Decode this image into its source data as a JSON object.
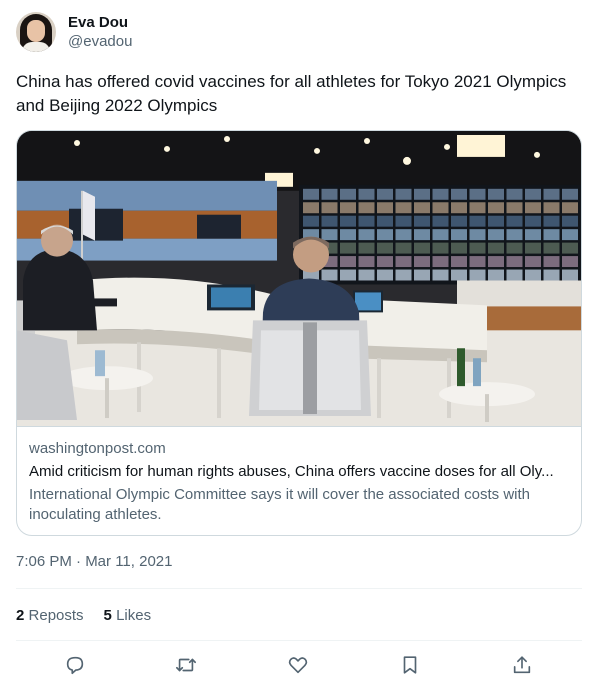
{
  "author": {
    "name": "Eva Dou",
    "handle": "@evadou"
  },
  "tweet": {
    "text": "China has offered covid vaccines for all  athletes for Tokyo 2021 Olympics and Beijing 2022 Olympics",
    "timestamp": "7:06 PM · Mar 11, 2021"
  },
  "card": {
    "domain": "washingtonpost.com",
    "title": "Amid criticism for human rights abuses, China offers vaccine doses for all Oly...",
    "description": "International Olympic Committee says it will cover the associated costs with inoculating athletes."
  },
  "stats": {
    "reposts_count": "2",
    "reposts_label": "Reposts",
    "likes_count": "5",
    "likes_label": "Likes"
  },
  "actions": [
    "reply-icon",
    "repost-icon",
    "like-icon",
    "bookmark-icon",
    "share-icon"
  ],
  "colors": {
    "text": "#0f1419",
    "secondary": "#536471",
    "border": "#cfd9de"
  }
}
